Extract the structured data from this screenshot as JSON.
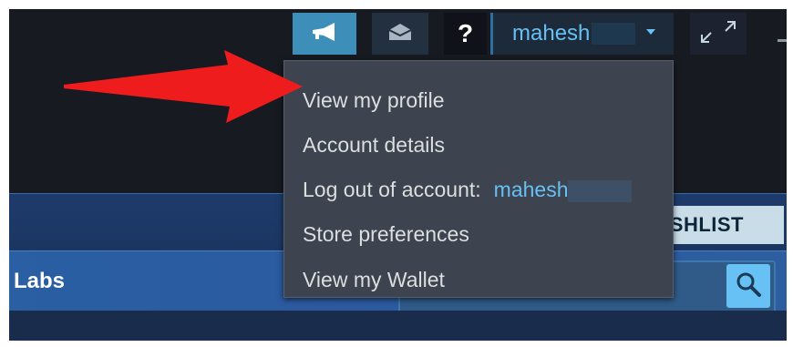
{
  "header": {
    "account_name": "mahesh",
    "help_label": "?"
  },
  "menu": {
    "items": [
      {
        "label": "View my profile"
      },
      {
        "label": "Account details"
      },
      {
        "label": "Log out of account:",
        "account": "mahesh"
      },
      {
        "label": "Store preferences"
      },
      {
        "label": "View my Wallet"
      }
    ]
  },
  "store": {
    "wishlist_label": "SHLIST",
    "nav_label": "Labs"
  },
  "colors": {
    "accent": "#3d8eb9",
    "link": "#66c0f4",
    "annotation_arrow": "#ee1c1c"
  },
  "icons": {
    "announcement": "megaphone-icon",
    "mail": "envelope-icon",
    "expand": "expand-arrows-icon",
    "search": "magnifier-icon"
  }
}
